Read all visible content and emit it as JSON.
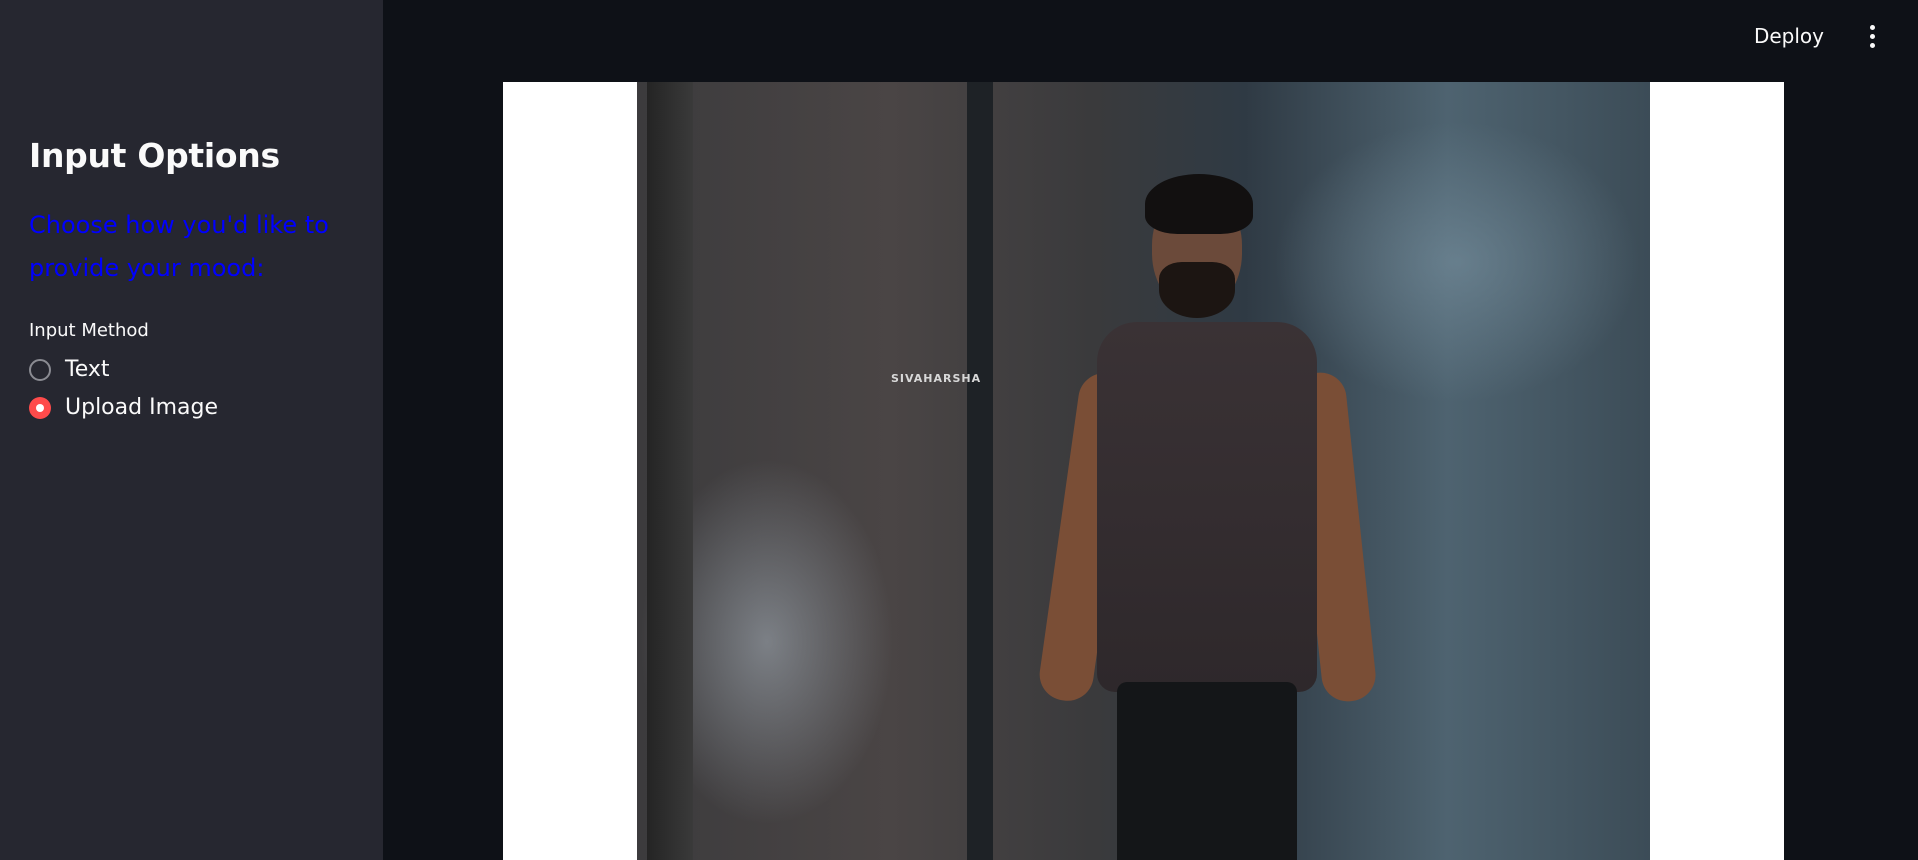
{
  "header": {
    "deploy_label": "Deploy",
    "menu_icon": "vertical-ellipsis-icon"
  },
  "sidebar": {
    "title": "Input Options",
    "subtitle": "Choose how you'd like to provide your mood:",
    "subtitle_color": "#0000ff",
    "radio_group_label": "Input Method",
    "options": [
      {
        "label": "Text",
        "selected": false
      },
      {
        "label": "Upload Image",
        "selected": true
      }
    ],
    "accent_color": "#ff4b4b"
  },
  "main": {
    "image": {
      "watermark": "SIVAHARSHA",
      "description_icon": "uploaded-photo"
    }
  }
}
